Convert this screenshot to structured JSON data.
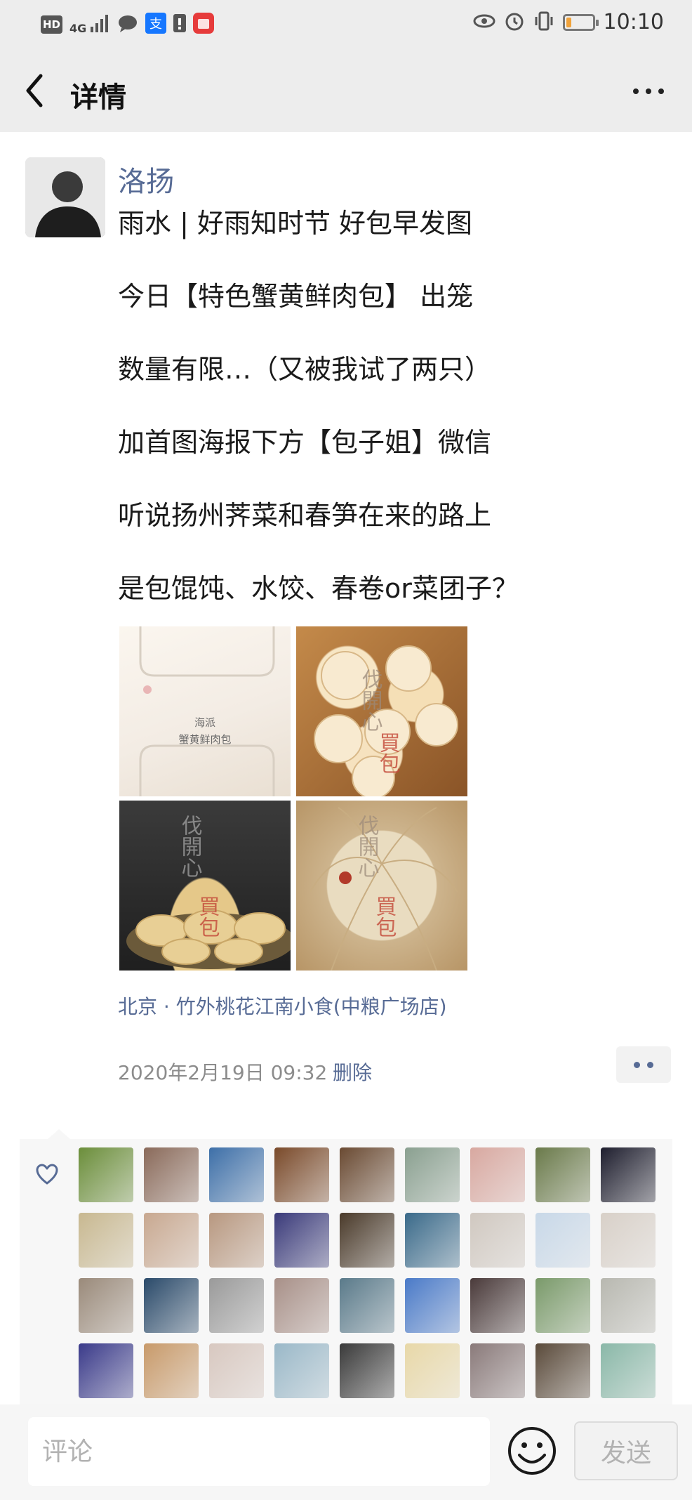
{
  "status_bar": {
    "left_chips": [
      "HD",
      "4G"
    ],
    "time": "10:10",
    "battery_level": 0.2,
    "icons": [
      "hd-icon",
      "signal-icon",
      "chat-icon",
      "alipay-icon",
      "alert-icon",
      "huawei-icon",
      "eye-icon",
      "alarm-icon",
      "vibrate-icon",
      "battery-icon"
    ]
  },
  "nav": {
    "title": "详情",
    "back_icon": "back-arrow-icon",
    "more_icon": "more-dots-icon"
  },
  "post": {
    "author": "洛扬",
    "lines": [
      "雨水 | 好雨知时节  好包早发图",
      "今日【特色蟹黄鲜肉包】 出笼",
      "数量有限…（又被我试了两只）",
      "加首图海报下方【包子姐】微信",
      "听说扬州荠菜和春笋在来的路上",
      "是包馄饨、水饺、春卷or菜团子？"
    ],
    "photos": [
      {
        "name": "photo-poster",
        "text": [
          "海派",
          "蟹黄鲜肉包"
        ]
      },
      {
        "name": "photo-steamer-buns",
        "text": [
          "伐開心",
          "買包"
        ]
      },
      {
        "name": "photo-dark-buns",
        "text": [
          "伐開心",
          "買包"
        ]
      },
      {
        "name": "photo-bun-closeup",
        "text": [
          "伐開心",
          "買包"
        ]
      }
    ],
    "location": "北京 · 竹外桃花江南小食(中粮广场店)",
    "timestamp": "2020年2月19日 09:32",
    "delete_label": "删除"
  },
  "likes": {
    "heart_icon": "heart-icon",
    "avatar_colors": [
      "#6b8e3a",
      "#8a6a5a",
      "#3d6fa8",
      "#7a4a2a",
      "#6a4a32",
      "#8aa090",
      "#d8a8a0",
      "#6a7a4a",
      "#1e1e2e",
      "#c8b890",
      "#c8a890",
      "#b89880",
      "#3a3a7a",
      "#4a3a2a",
      "#3a6a8a",
      "#d0c8c0",
      "#c8d8e8",
      "#d8d0c8",
      "#9a8a7a",
      "#2a4a6a",
      "#9a9a9a",
      "#a89088",
      "#5a7a8a",
      "#4a7ac8",
      "#4a3a3a",
      "#7a9a6a",
      "#b8b8b0",
      "#3a3a8a",
      "#c89a6a",
      "#d8c8c0",
      "#9ab8c8",
      "#3a3a3a",
      "#e8d8a8",
      "#8a7a7a",
      "#5a4a3a",
      "#8ab8a8"
    ]
  },
  "comment": {
    "placeholder": "评论",
    "emoji_icon": "emoji-icon",
    "send_label": "发送"
  }
}
